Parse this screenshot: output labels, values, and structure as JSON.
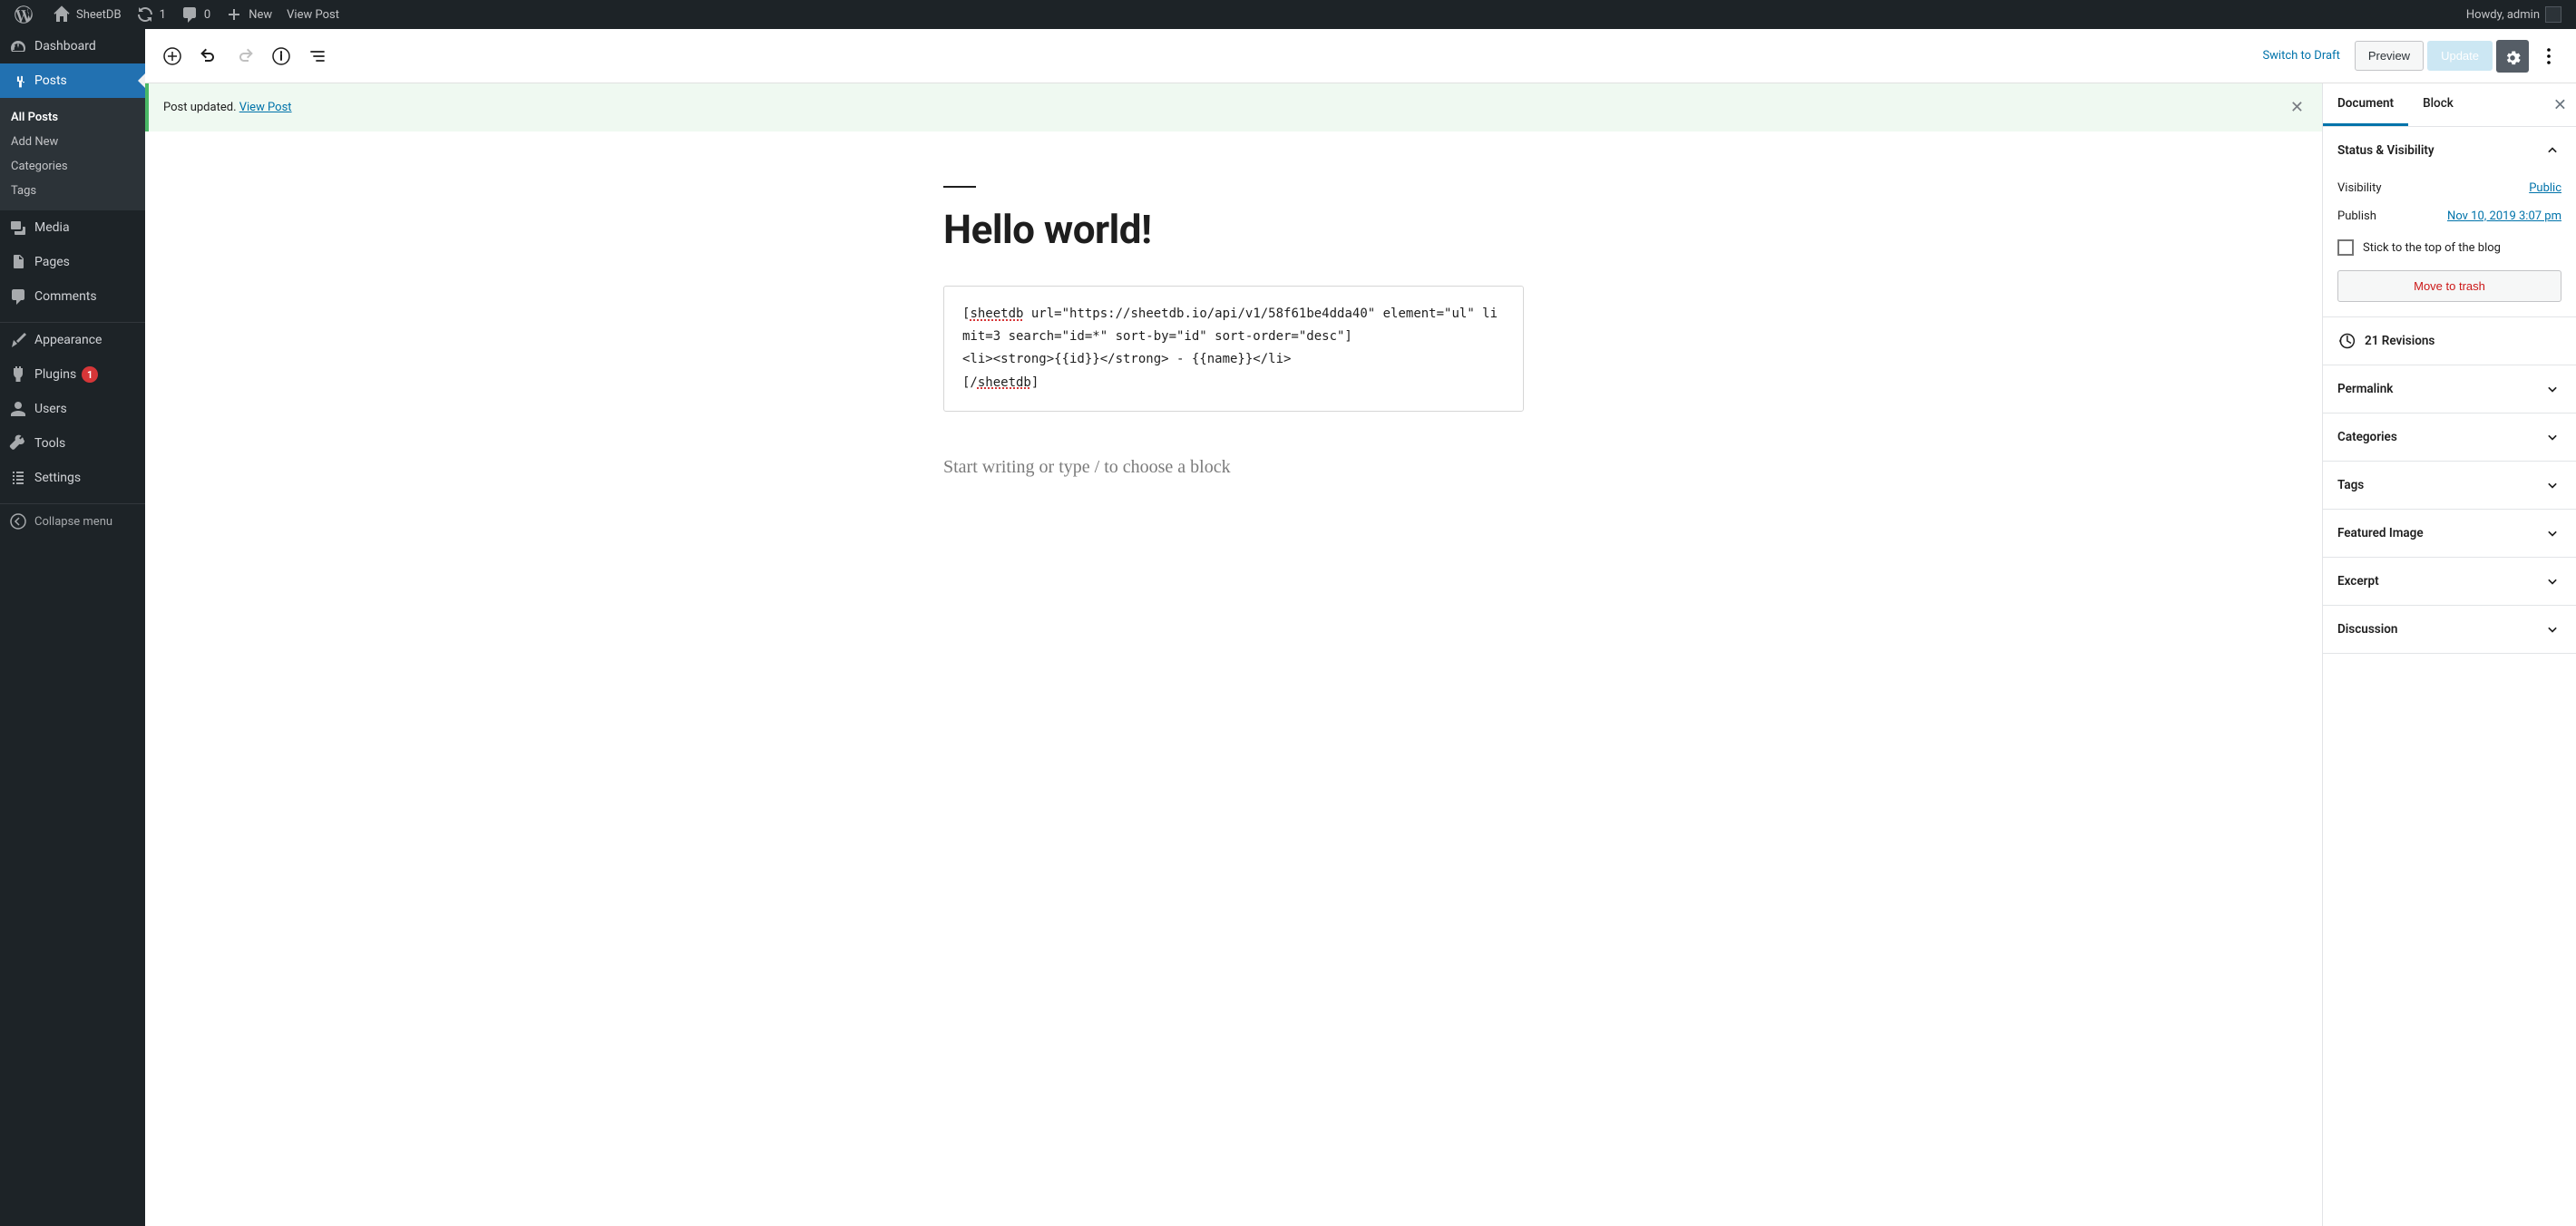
{
  "adminbar": {
    "site_name": "SheetDB",
    "updates": "1",
    "comments": "0",
    "new": "New",
    "view_post": "View Post",
    "howdy": "Howdy, admin"
  },
  "sidebar": {
    "dashboard": "Dashboard",
    "posts": "Posts",
    "posts_sub": {
      "all": "All Posts",
      "add": "Add New",
      "categories": "Categories",
      "tags": "Tags"
    },
    "media": "Media",
    "pages": "Pages",
    "comments": "Comments",
    "appearance": "Appearance",
    "plugins": "Plugins",
    "plugins_badge": "1",
    "users": "Users",
    "tools": "Tools",
    "settings": "Settings",
    "collapse": "Collapse menu"
  },
  "toolbar": {
    "switch_draft": "Switch to Draft",
    "preview": "Preview",
    "update": "Update"
  },
  "notice": {
    "text": "Post updated. ",
    "link": "View Post"
  },
  "post": {
    "title": "Hello world!",
    "code_l1a": "[",
    "code_l1b": "sheetdb",
    "code_l1c": " url=\"https://sheetdb.io/api/v1/58f61be4dda40\" element=\"ul\" limit=3 search=\"id=*\" sort-by=\"id\" sort-order=\"desc\"]",
    "code_l2": "<li><strong>{{id}}</strong> - {{name}}</li>",
    "code_l3a": "[/",
    "code_l3b": "sheetdb",
    "code_l3c": "]",
    "placeholder": "Start writing or type / to choose a block"
  },
  "panel": {
    "tab_document": "Document",
    "tab_block": "Block",
    "status": {
      "heading": "Status & Visibility",
      "visibility_label": "Visibility",
      "visibility_value": "Public",
      "publish_label": "Publish",
      "publish_value": "Nov 10, 2019 3:07 pm",
      "stick": "Stick to the top of the blog",
      "trash": "Move to trash"
    },
    "revisions": "21 Revisions",
    "permalink": "Permalink",
    "categories": "Categories",
    "tags": "Tags",
    "featured": "Featured Image",
    "excerpt": "Excerpt",
    "discussion": "Discussion"
  }
}
